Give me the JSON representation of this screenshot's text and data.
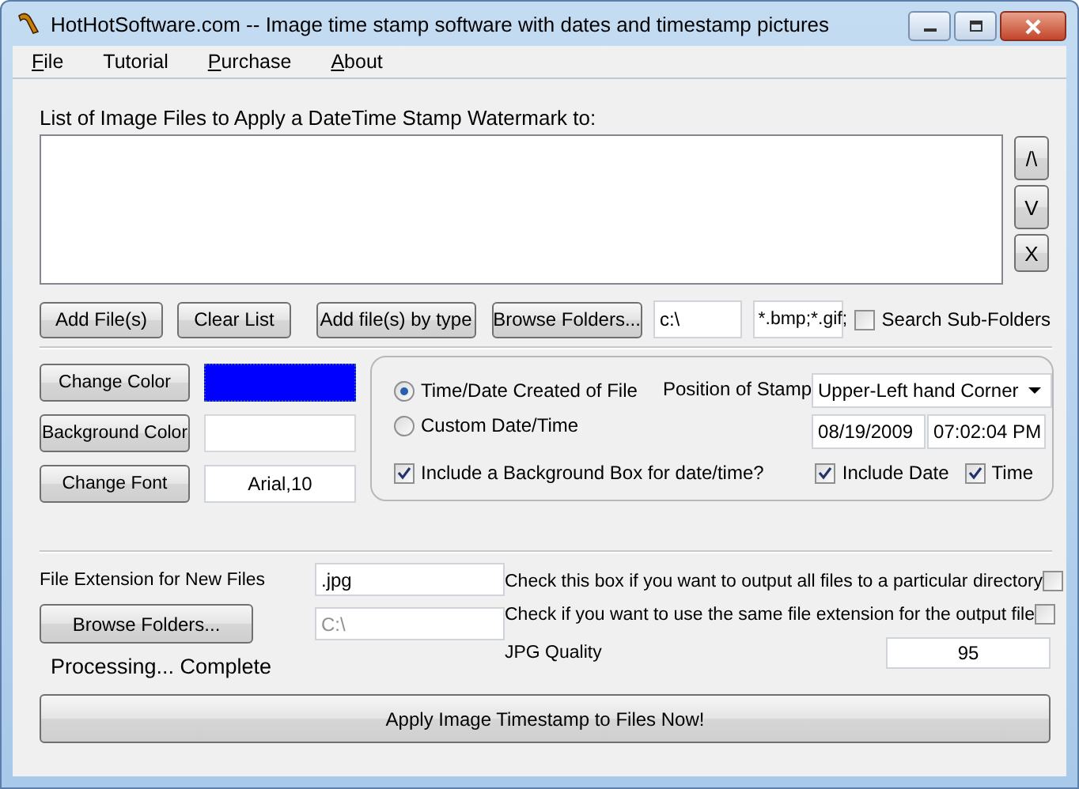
{
  "window": {
    "title": "HotHotSoftware.com -- Image time stamp software with dates and timestamp pictures"
  },
  "menu": [
    {
      "label": "File",
      "mnemonic": true
    },
    {
      "label": "Tutorial",
      "mnemonic": false
    },
    {
      "label": "Purchase",
      "mnemonic": true
    },
    {
      "label": "About",
      "mnemonic": true
    }
  ],
  "file_list": {
    "label": "List of Image Files to Apply a DateTime Stamp Watermark to:",
    "side_buttons": [
      "/\\",
      "V",
      "X"
    ]
  },
  "file_buttons": [
    "Add File(s)",
    "Clear List",
    "Add file(s) by type",
    "Browse Folders..."
  ],
  "folder_field": {
    "value": "c:\\"
  },
  "types_field": {
    "value": "*.bmp;*.gif;"
  },
  "search_subfolders": {
    "label": "Search Sub-Folders",
    "checked": false
  },
  "style_controls": [
    {
      "button": "Change Color",
      "kind": "swatch",
      "color": "#0000ff"
    },
    {
      "button": "Background Color",
      "kind": "swatch",
      "color": "#ffffff"
    },
    {
      "button": "Change Font",
      "kind": "text",
      "value": "Arial,10"
    }
  ],
  "date_source": [
    {
      "label": "Time/Date Created of File",
      "selected": true
    },
    {
      "label": "Custom Date/Time",
      "selected": false
    }
  ],
  "position": {
    "label": "Position of Stamp",
    "value": "Upper-Left hand Corner"
  },
  "custom_date": {
    "date": "08/19/2009",
    "time": "07:02:04 PM"
  },
  "include_background": {
    "label": "Include a Background Box for date/time?",
    "checked": true
  },
  "include_date": {
    "label": "Include Date",
    "checked": true
  },
  "include_time": {
    "label": "Time",
    "checked": true
  },
  "extension": {
    "label": "File Extension for New Files",
    "value": ".jpg"
  },
  "output_browse": {
    "button": "Browse Folders...",
    "value": "C:\\",
    "disabled": true
  },
  "output_options": [
    {
      "label": "Check this box if you want to output all files to a particular directory",
      "checked": false
    },
    {
      "label": "Check if you want to use the same file extension for the output file",
      "checked": false
    }
  ],
  "status": "Processing... Complete",
  "jpg_quality": {
    "label": "JPG Quality",
    "value": "95"
  },
  "apply_button": "Apply Image Timestamp to Files Now!"
}
